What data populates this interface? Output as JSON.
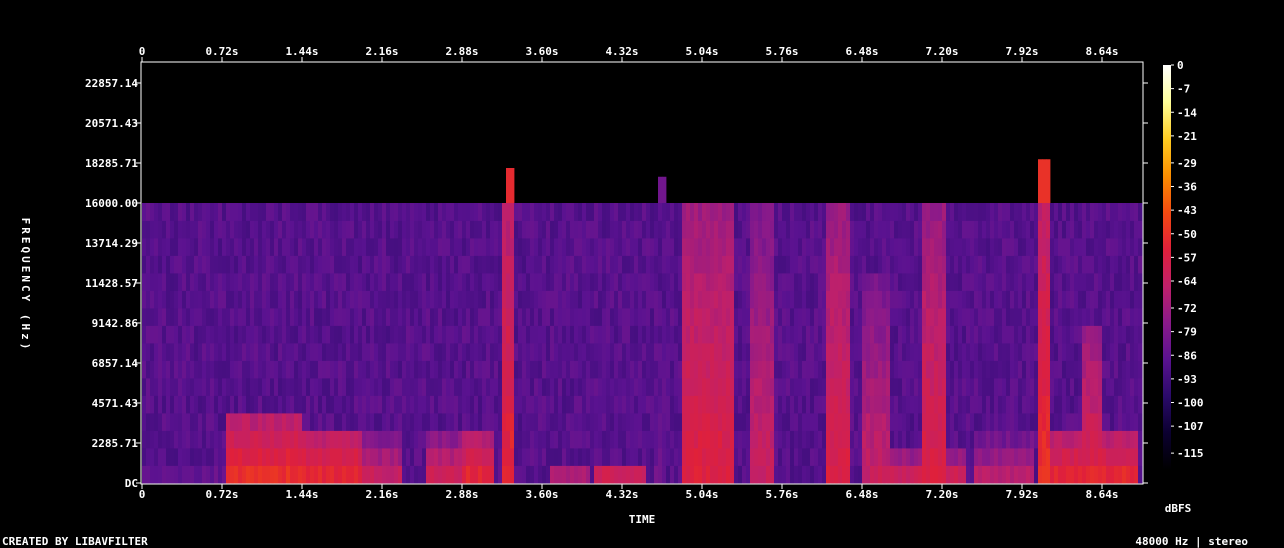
{
  "chart_data": {
    "type": "heatmap",
    "subtype": "spectrogram",
    "xlabel": "TIME",
    "ylabel": "FREQUENCY (Hz)",
    "x_ticks": [
      "0",
      "0.72s",
      "1.44s",
      "2.16s",
      "2.88s",
      "3.60s",
      "4.32s",
      "5.04s",
      "5.76s",
      "6.48s",
      "7.20s",
      "7.92s",
      "8.64s"
    ],
    "x_tick_values": [
      0,
      0.72,
      1.44,
      2.16,
      2.88,
      3.6,
      4.32,
      5.04,
      5.76,
      6.48,
      7.2,
      7.92,
      8.64
    ],
    "xlim": [
      0,
      9.0
    ],
    "y_ticks": [
      "22857.14",
      "20571.43",
      "18285.71",
      "16000.00",
      "13714.29",
      "11428.57",
      "9142.86",
      "6857.14",
      "4571.43",
      "2285.71",
      "DC"
    ],
    "y_tick_values": [
      22857.14,
      20571.43,
      18285.71,
      16000.0,
      13714.29,
      11428.57,
      9142.86,
      6857.14,
      4571.43,
      2285.71,
      0
    ],
    "ylim": [
      0,
      24000
    ],
    "colorbar": {
      "label": "dBFS",
      "ticks": [
        "0",
        "-7",
        "-14",
        "-21",
        "-29",
        "-36",
        "-43",
        "-50",
        "-57",
        "-64",
        "-72",
        "-79",
        "-86",
        "-93",
        "-100",
        "-107",
        "-115"
      ],
      "tick_values": [
        0,
        -7,
        -14,
        -21,
        -29,
        -36,
        -43,
        -50,
        -57,
        -64,
        -72,
        -79,
        -86,
        -93,
        -100,
        -107,
        -115
      ],
      "range": [
        -120,
        0
      ],
      "stops": [
        "#000000",
        "#0b0030",
        "#2a0a6a",
        "#5a1290",
        "#8a1a8a",
        "#c0206a",
        "#e0203a",
        "#f54a10",
        "#fb8e00",
        "#ffcc22",
        "#ffff99",
        "#ffffff"
      ]
    },
    "cutoff_frequency": 16000,
    "noise_floor_dbfs": -88,
    "events": [
      {
        "t": 0.0,
        "w": 0.75,
        "db": -70,
        "f": 600
      },
      {
        "t": 0.8,
        "w": 0.6,
        "db": -48,
        "f": 3500
      },
      {
        "t": 1.4,
        "w": 0.55,
        "db": -50,
        "f": 3000
      },
      {
        "t": 2.0,
        "w": 0.3,
        "db": -60,
        "f": 2500
      },
      {
        "t": 2.6,
        "w": 0.3,
        "db": -58,
        "f": 2500
      },
      {
        "t": 2.9,
        "w": 0.25,
        "db": -50,
        "f": 2500
      },
      {
        "t": 3.28,
        "w": 0.05,
        "db": -52,
        "f": 18000
      },
      {
        "t": 3.7,
        "w": 0.3,
        "db": -62,
        "f": 1200
      },
      {
        "t": 4.1,
        "w": 0.4,
        "db": -55,
        "f": 1400
      },
      {
        "t": 4.65,
        "w": 0.05,
        "db": -82,
        "f": 17500
      },
      {
        "t": 4.9,
        "w": 0.4,
        "db": -55,
        "f": 16000
      },
      {
        "t": 5.5,
        "w": 0.15,
        "db": -62,
        "f": 16000
      },
      {
        "t": 6.2,
        "w": 0.15,
        "db": -56,
        "f": 16000
      },
      {
        "t": 6.5,
        "w": 0.2,
        "db": -63,
        "f": 12000
      },
      {
        "t": 6.6,
        "w": 0.8,
        "db": -56,
        "f": 1500
      },
      {
        "t": 7.05,
        "w": 0.15,
        "db": -56,
        "f": 16000
      },
      {
        "t": 7.5,
        "w": 0.5,
        "db": -64,
        "f": 2500
      },
      {
        "t": 8.1,
        "w": 0.05,
        "db": -50,
        "f": 18500
      },
      {
        "t": 8.1,
        "w": 0.85,
        "db": -50,
        "f": 2800
      },
      {
        "t": 8.5,
        "w": 0.1,
        "db": -56,
        "f": 9000
      }
    ]
  },
  "footer": {
    "credit": "CREATED BY LIBAVFILTER",
    "format": "48000 Hz | stereo"
  }
}
